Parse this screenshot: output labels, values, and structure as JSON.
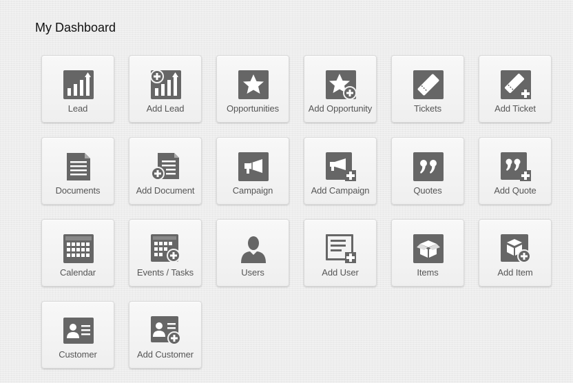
{
  "page": {
    "title": "My Dashboard"
  },
  "tiles": [
    {
      "label": "Lead",
      "icon": "bar-chart-icon"
    },
    {
      "label": "Add Lead",
      "icon": "add-bar-chart-icon"
    },
    {
      "label": "Opportunities",
      "icon": "star-icon"
    },
    {
      "label": "Add Opportunity",
      "icon": "add-star-icon"
    },
    {
      "label": "Tickets",
      "icon": "ticket-icon"
    },
    {
      "label": "Add Ticket",
      "icon": "add-ticket-icon"
    },
    {
      "label": "Documents",
      "icon": "document-icon"
    },
    {
      "label": "Add Document",
      "icon": "add-document-icon"
    },
    {
      "label": "Campaign",
      "icon": "megaphone-icon"
    },
    {
      "label": "Add Campaign",
      "icon": "add-megaphone-icon"
    },
    {
      "label": "Quotes",
      "icon": "quote-icon"
    },
    {
      "label": "Add Quote",
      "icon": "add-quote-icon"
    },
    {
      "label": "Calendar",
      "icon": "calendar-icon"
    },
    {
      "label": "Events / Tasks",
      "icon": "add-calendar-icon"
    },
    {
      "label": "Users",
      "icon": "user-icon"
    },
    {
      "label": "Add User",
      "icon": "add-user-icon"
    },
    {
      "label": "Items",
      "icon": "box-icon"
    },
    {
      "label": "Add Item",
      "icon": "add-box-icon"
    },
    {
      "label": "Customer",
      "icon": "contact-card-icon"
    },
    {
      "label": "Add Customer",
      "icon": "add-contact-card-icon"
    }
  ],
  "colors": {
    "icon": "#666666",
    "label": "#555555",
    "tile_border": "#dadada"
  }
}
